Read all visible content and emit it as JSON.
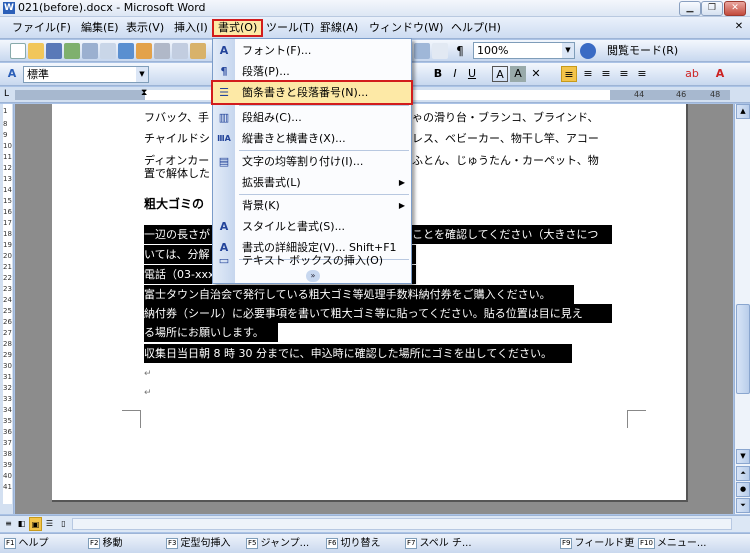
{
  "window": {
    "title": "021(before).docx - Microsoft Word",
    "app_icon": "W"
  },
  "menubar": {
    "items": [
      {
        "label": "ファイル(F)"
      },
      {
        "label": "編集(E)"
      },
      {
        "label": "表示(V)"
      },
      {
        "label": "挿入(I)"
      },
      {
        "label": "書式(O)"
      },
      {
        "label": "ツール(T)"
      },
      {
        "label": "罫線(A)"
      },
      {
        "label": "ウィンドウ(W)"
      },
      {
        "label": "ヘルプ(H)"
      }
    ]
  },
  "toolbar_standard": {
    "zoom": "100%",
    "reading_mode": "閲覧モード(R)"
  },
  "toolbar_format": {
    "style": "標準"
  },
  "ruler": {
    "numbers": [
      "44",
      "46",
      "48"
    ]
  },
  "vruler": {
    "numbers": [
      "1",
      "8",
      "9",
      "10",
      "11",
      "12",
      "13",
      "14",
      "15",
      "16",
      "17",
      "18",
      "19",
      "20",
      "21",
      "22",
      "23",
      "24",
      "25",
      "26",
      "27",
      "28",
      "29",
      "30",
      "31",
      "32",
      "33",
      "34",
      "35",
      "36",
      "37",
      "38",
      "39",
      "40",
      "41"
    ]
  },
  "document": {
    "lines": [
      "フバック、手",
      "チャイルドシ",
      "ディオンカー",
      "置で解体した",
      "粗大ゴミの",
      "一辺の長さが",
      "いては、分解",
      "電話（03-xxx",
      "富士タウン自治会で発行している粗大ゴミ等処理手数料納付券をご購入ください。",
      "納付券（シール）に必要事項を書いて粗大ゴミ等に貼ってください。貼る位置は目に見え",
      "る場所にお願いします。",
      "収集日当日朝 8 時 30 分までに、申込時に確認した場所にゴミを出してください。"
    ],
    "right_fragments": [
      "ゃの滑り台・ブランコ、ブラインド、",
      "レス、ベビーカー、物干し竿、アコー",
      "ふとん、じゅうたん・カーペット、物",
      "ことを確認してください（大きさにつ"
    ],
    "para_mark": "↵"
  },
  "format_menu": {
    "items": [
      {
        "icon": "A",
        "label": "フォント(F)...",
        "shortcut": "",
        "submenu": false
      },
      {
        "icon": "¶",
        "label": "段落(P)...",
        "shortcut": "",
        "submenu": false
      },
      {
        "icon": "☰",
        "label": "箇条書きと段落番号(N)...",
        "shortcut": "",
        "submenu": false,
        "highlighted": true
      },
      {
        "icon": "▥",
        "label": "段組み(C)...",
        "shortcut": "",
        "submenu": false
      },
      {
        "icon": "ⅢA",
        "label": "縦書きと横書き(X)...",
        "shortcut": "",
        "submenu": false
      },
      {
        "icon": "▤",
        "label": "文字の均等割り付け(I)...",
        "shortcut": "",
        "submenu": false
      },
      {
        "icon": "",
        "label": "拡張書式(L)",
        "shortcut": "",
        "submenu": true
      },
      {
        "icon": "",
        "label": "背景(K)",
        "shortcut": "",
        "submenu": true
      },
      {
        "icon": "A",
        "label": "スタイルと書式(S)...",
        "shortcut": "",
        "submenu": false
      },
      {
        "icon": "A",
        "label": "書式の詳細設定(V)...",
        "shortcut": "Shift+F1",
        "submenu": false
      },
      {
        "icon": "▭",
        "label": "テキスト ボックスの挿入(O)",
        "shortcut": "",
        "submenu": false
      }
    ],
    "expand_icon": "»"
  },
  "function_keys": [
    {
      "num": "F1",
      "label": "ヘルプ"
    },
    {
      "num": "F2",
      "label": "移動"
    },
    {
      "num": "F3",
      "label": "定型句挿入"
    },
    {
      "num": "F5",
      "label": "ジャンプ..."
    },
    {
      "num": "F6",
      "label": "切り替え"
    },
    {
      "num": "F7",
      "label": "スペル チ..."
    },
    {
      "num": "F9",
      "label": "フィールド更"
    },
    {
      "num": "F10",
      "label": "メニュー..."
    }
  ],
  "colors": {
    "highlight": "#fde9a6",
    "red_outline": "#d21c1c",
    "ribbon_blue": "#cddcf1"
  }
}
